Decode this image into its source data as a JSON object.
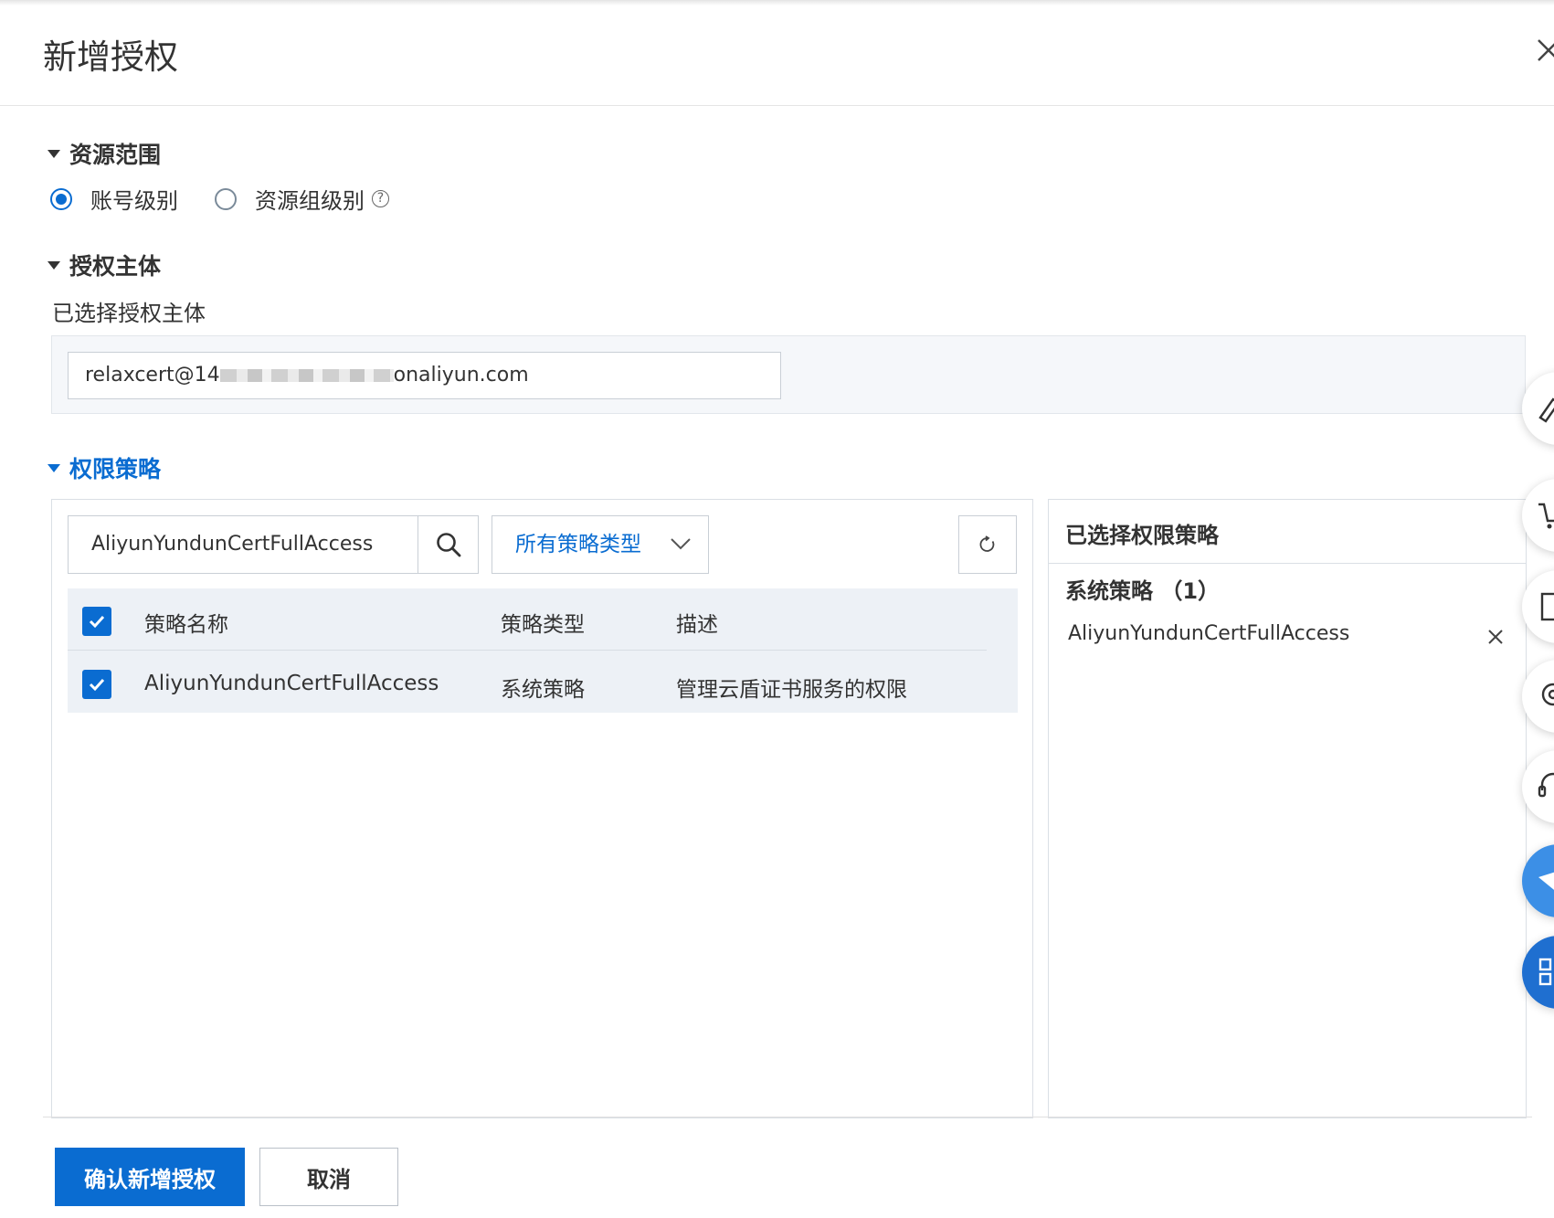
{
  "dialog": {
    "title": "新增授权"
  },
  "resource_scope": {
    "heading": "资源范围",
    "options": [
      {
        "label": "账号级别",
        "selected": true
      },
      {
        "label": "资源组级别",
        "selected": false
      }
    ]
  },
  "principal": {
    "heading": "授权主体",
    "selected_label": "已选择授权主体",
    "value_prefix": "relaxcert@14",
    "value_suffix": "onaliyun.com"
  },
  "policy": {
    "heading": "权限策略",
    "search_value": "AliyunYundunCertFullAccess",
    "type_filter": "所有策略类型",
    "columns": [
      "策略名称",
      "策略类型",
      "描述"
    ],
    "rows": [
      {
        "name": "AliyunYundunCertFullAccess",
        "type": "系统策略",
        "desc": "管理云盾证书服务的权限",
        "checked": true
      }
    ],
    "header_checked": true
  },
  "selected_panel": {
    "title": "已选择权限策略",
    "group_label": "系统策略 （1）",
    "items": [
      "AliyunYundunCertFullAccess"
    ]
  },
  "footer": {
    "confirm_label": "确认新增授权",
    "cancel_label": "取消"
  },
  "colors": {
    "accent": "#0a6cd1"
  }
}
